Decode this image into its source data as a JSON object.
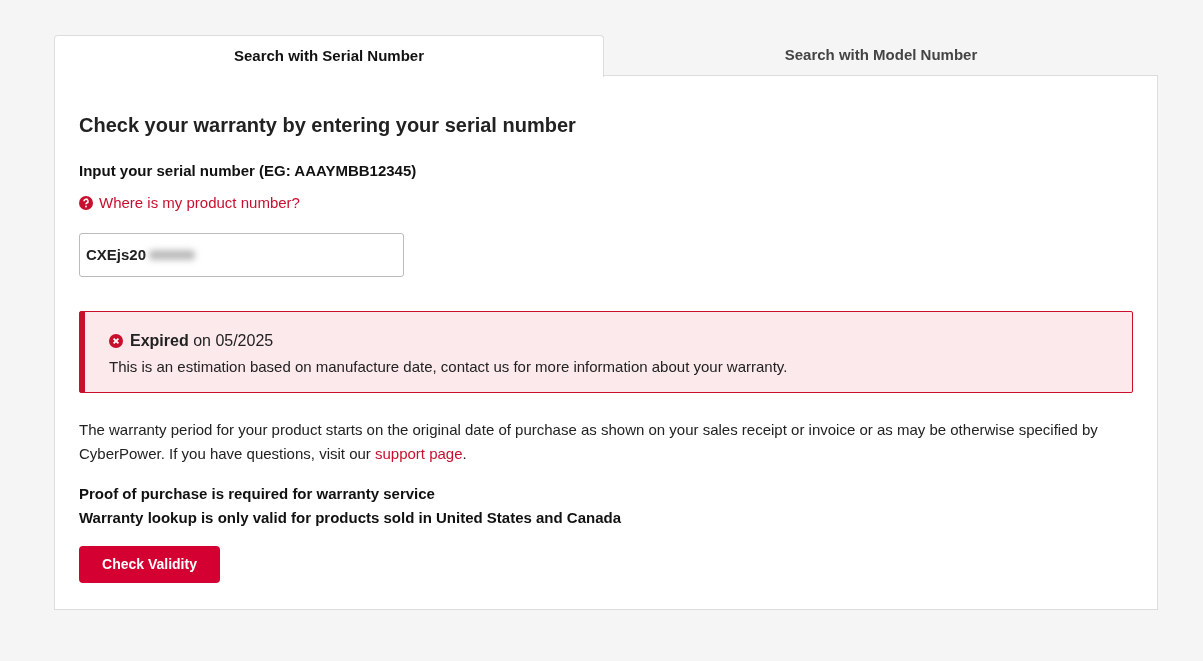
{
  "tabs": [
    {
      "label": "Search with Serial Number",
      "selected": true
    },
    {
      "label": "Search with Model Number",
      "selected": false
    }
  ],
  "heading": "Check your warranty by entering your serial number",
  "field_label": "Input your serial number (EG: AAAYMBB12345)",
  "help_link": "Where is my product number?",
  "serial_field": {
    "value": "CXEjs20",
    "redacted": true
  },
  "alert": {
    "kind": "error",
    "title": "**Expired** on 05/2025",
    "message": "This is an estimation based on manufacture date, contact us for more information about your warranty."
  },
  "info": {
    "text": "The warranty period for your product starts on the original date of purchase as shown on your sales receipt or invoice or as may be otherwise specified by CyberPower. If you have questions, visit our ",
    "link": "support page",
    "text_after": "."
  },
  "notes": [
    "Proof of purchase is required for warranty service",
    "Warranty lookup is only valid for products sold in United States and Canada"
  ],
  "button": "Check Validity"
}
